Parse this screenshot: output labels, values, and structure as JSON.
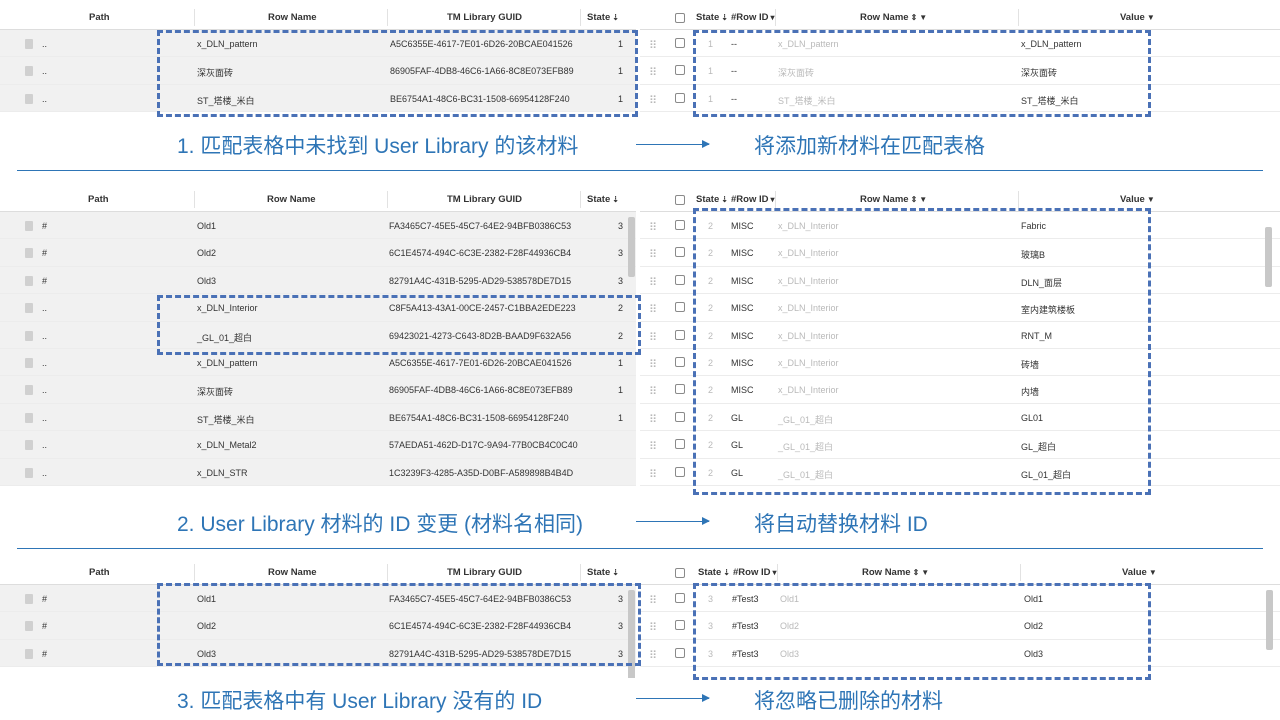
{
  "left_headers": {
    "path": "Path",
    "row_name": "Row Name",
    "guid": "TM Library GUID",
    "state": "State"
  },
  "right_headers": {
    "state": "State",
    "row_id": "#Row ID",
    "row_name": "Row Name",
    "value": "Value"
  },
  "icons": {
    "sort": "sort-arrows-icon",
    "filter": "filter-funnel-icon",
    "file": "file-icon",
    "grip": "drag-grip-icon"
  },
  "colors": {
    "accent": "#2e75b6",
    "dash": "#4a71b6"
  },
  "panel1": {
    "left_rows": [
      {
        "path": "..",
        "name": "x_DLN_pattern",
        "guid": "A5C6355E-4617-7E01-6D26-20BCAE041526",
        "state": "1"
      },
      {
        "path": "..",
        "name": "深灰面砖",
        "guid": "86905FAF-4DB8-46C6-1A66-8C8E073EFB89",
        "state": "1"
      },
      {
        "path": "..",
        "name": "ST_塔楼_米白",
        "guid": "BE6754A1-48C6-BC31-1508-66954128F240",
        "state": "1"
      }
    ],
    "right_rows": [
      {
        "state": "1",
        "row_id": "--",
        "name": "x_DLN_pattern",
        "value": "x_DLN_pattern"
      },
      {
        "state": "1",
        "row_id": "--",
        "name": "深灰面砖",
        "value": "深灰面砖"
      },
      {
        "state": "1",
        "row_id": "--",
        "name": "ST_塔楼_米白",
        "value": "ST_塔楼_米白"
      }
    ],
    "caption_left": "1. 匹配表格中未找到 User Library 的该材料",
    "caption_right": "将添加新材料在匹配表格"
  },
  "panel2": {
    "left_rows": [
      {
        "path": "#",
        "name": "Old1",
        "guid": "FA3465C7-45E5-45C7-64E2-94BFB0386C53",
        "state": "3"
      },
      {
        "path": "#",
        "name": "Old2",
        "guid": "6C1E4574-494C-6C3E-2382-F28F44936CB4",
        "state": "3"
      },
      {
        "path": "#",
        "name": "Old3",
        "guid": "82791A4C-431B-5295-AD29-538578DE7D15",
        "state": "3"
      },
      {
        "path": "..",
        "name": "x_DLN_Interior",
        "guid": "C8F5A413-43A1-00CE-2457-C1BBA2EDE223",
        "state": "2"
      },
      {
        "path": "..",
        "name": "_GL_01_超白",
        "guid": "69423021-4273-C643-8D2B-BAAD9F632A56",
        "state": "2"
      },
      {
        "path": "..",
        "name": "x_DLN_pattern",
        "guid": "A5C6355E-4617-7E01-6D26-20BCAE041526",
        "state": "1"
      },
      {
        "path": "..",
        "name": "深灰面砖",
        "guid": "86905FAF-4DB8-46C6-1A66-8C8E073EFB89",
        "state": "1"
      },
      {
        "path": "..",
        "name": "ST_塔楼_米白",
        "guid": "BE6754A1-48C6-BC31-1508-66954128F240",
        "state": "1"
      },
      {
        "path": "..",
        "name": "x_DLN_Metal2",
        "guid": "57AEDA51-462D-D17C-9A94-77B0CB4C0C40",
        "state": ""
      },
      {
        "path": "..",
        "name": "x_DLN_STR",
        "guid": "1C3239F3-4285-A35D-D0BF-A589898B4B4D",
        "state": ""
      }
    ],
    "right_rows": [
      {
        "state": "2",
        "row_id": "MISC",
        "name": "x_DLN_Interior",
        "value": "Fabric"
      },
      {
        "state": "2",
        "row_id": "MISC",
        "name": "x_DLN_Interior",
        "value": "玻璃B"
      },
      {
        "state": "2",
        "row_id": "MISC",
        "name": "x_DLN_Interior",
        "value": "DLN_面层"
      },
      {
        "state": "2",
        "row_id": "MISC",
        "name": "x_DLN_Interior",
        "value": "室内建筑楼板"
      },
      {
        "state": "2",
        "row_id": "MISC",
        "name": "x_DLN_Interior",
        "value": "RNT_M"
      },
      {
        "state": "2",
        "row_id": "MISC",
        "name": "x_DLN_Interior",
        "value": "砖墙"
      },
      {
        "state": "2",
        "row_id": "MISC",
        "name": "x_DLN_Interior",
        "value": "内墙"
      },
      {
        "state": "2",
        "row_id": "GL",
        "name": "_GL_01_超白",
        "value": "GL01"
      },
      {
        "state": "2",
        "row_id": "GL",
        "name": "_GL_01_超白",
        "value": "GL_超白"
      },
      {
        "state": "2",
        "row_id": "GL",
        "name": "_GL_01_超白",
        "value": "GL_01_超白"
      }
    ],
    "caption_left": "2. User Library 材料的 ID 变更 (材料名相同)",
    "caption_right": "将自动替换材料 ID"
  },
  "panel3": {
    "left_rows": [
      {
        "path": "#",
        "name": "Old1",
        "guid": "FA3465C7-45E5-45C7-64E2-94BFB0386C53",
        "state": "3"
      },
      {
        "path": "#",
        "name": "Old2",
        "guid": "6C1E4574-494C-6C3E-2382-F28F44936CB4",
        "state": "3"
      },
      {
        "path": "#",
        "name": "Old3",
        "guid": "82791A4C-431B-5295-AD29-538578DE7D15",
        "state": "3"
      }
    ],
    "right_rows": [
      {
        "state": "3",
        "row_id": "#Test3",
        "name": "Old1",
        "value": "Old1"
      },
      {
        "state": "3",
        "row_id": "#Test3",
        "name": "Old2",
        "value": "Old2"
      },
      {
        "state": "3",
        "row_id": "#Test3",
        "name": "Old3",
        "value": "Old3"
      }
    ],
    "caption_left": "3. 匹配表格中有 User Library 没有的 ID",
    "caption_right": "将忽略已删除的材料"
  }
}
